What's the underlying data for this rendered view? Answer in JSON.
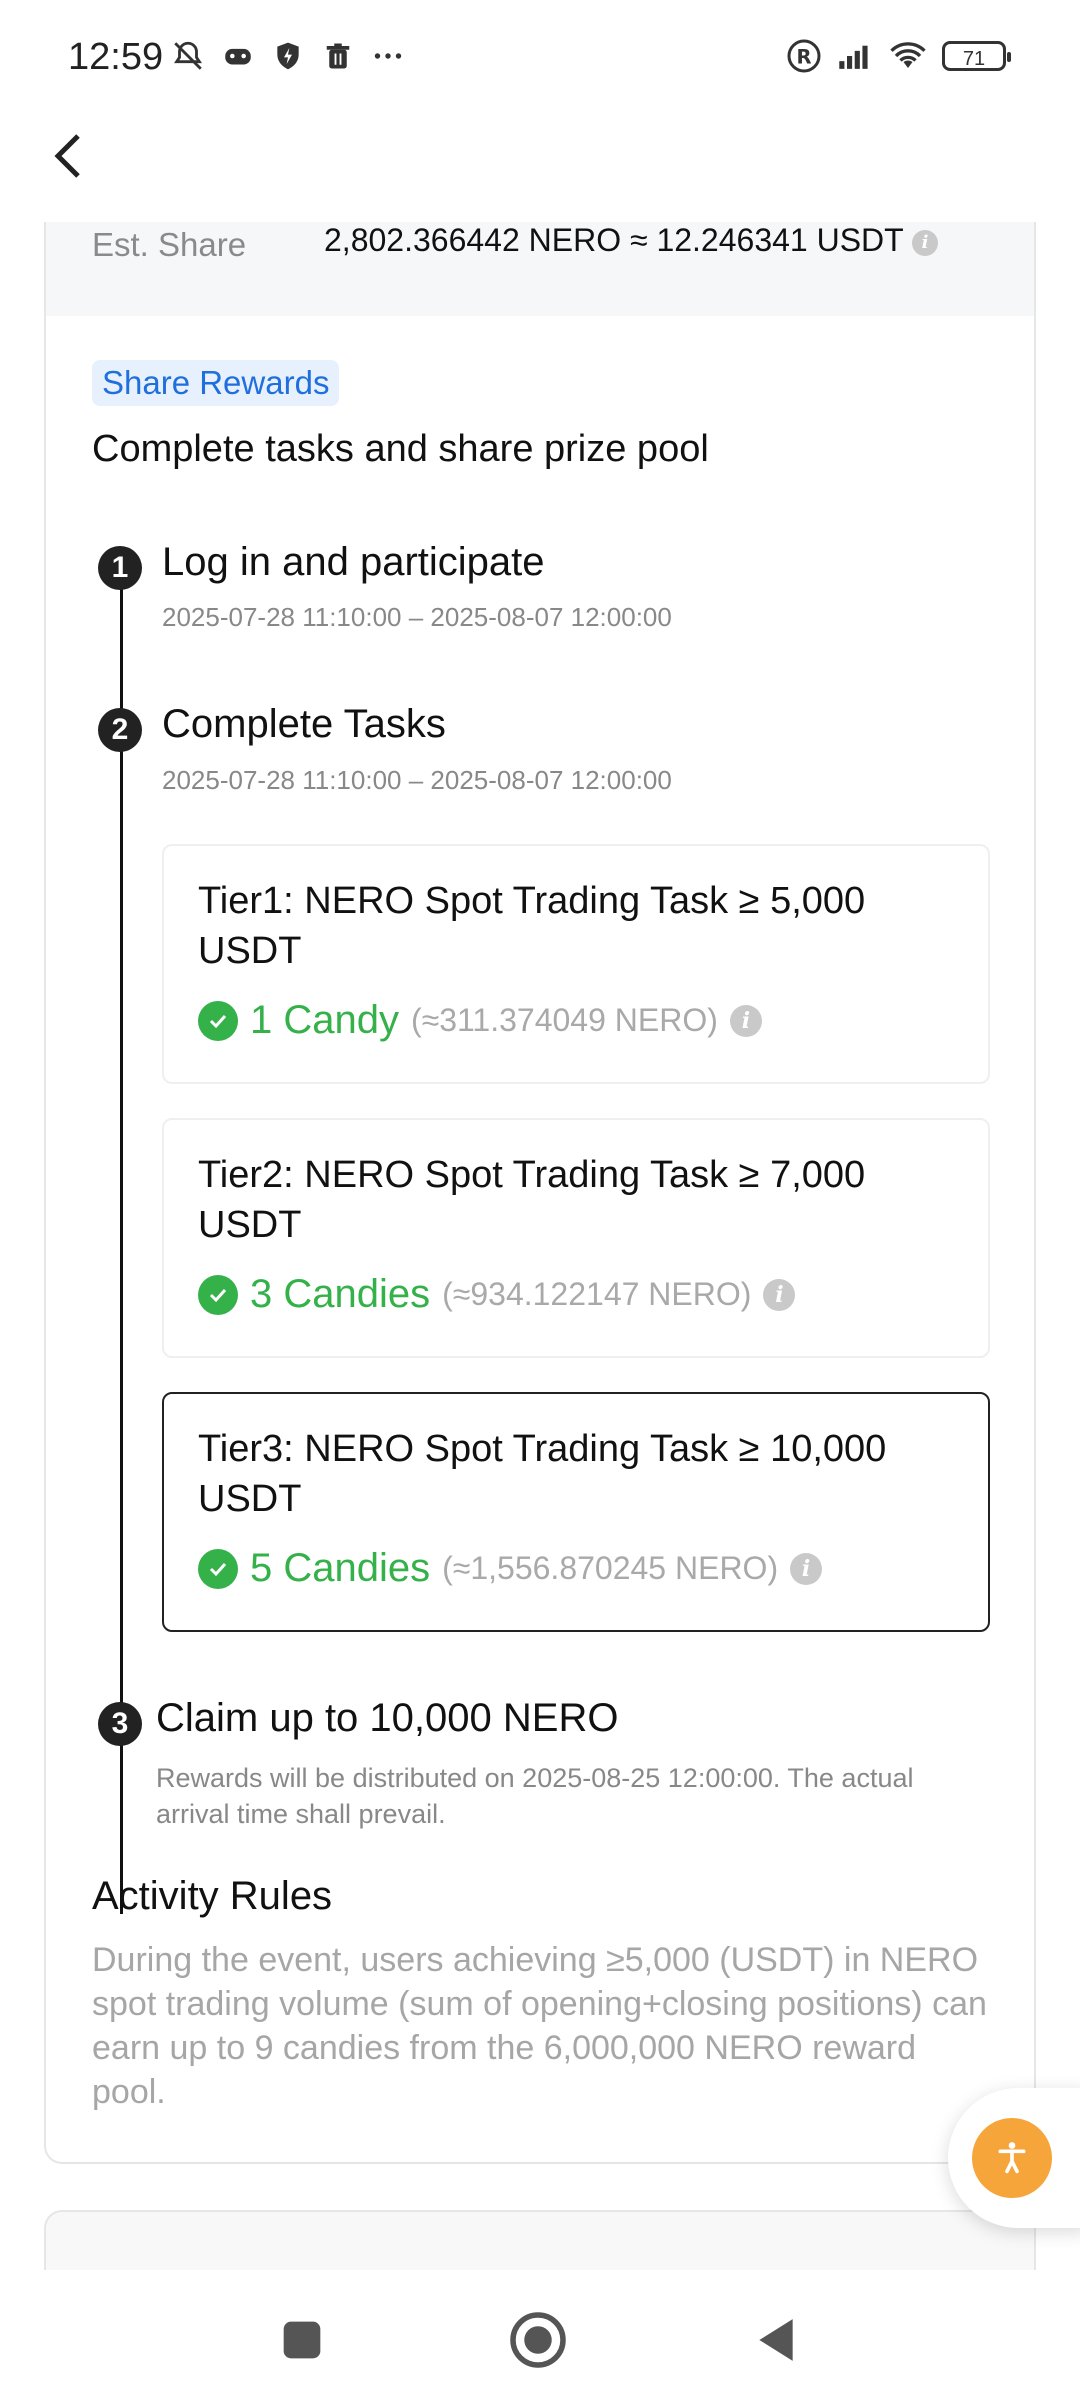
{
  "status_bar": {
    "time": "12:59",
    "battery": "71"
  },
  "share": {
    "label": "Est. Share",
    "value": "2,802.366442 NERO ≈ 12.246341 USDT"
  },
  "badge": "Share Rewards",
  "heading": "Complete tasks and share prize pool",
  "steps": [
    {
      "num": "1",
      "title": "Log in and participate",
      "date": "2025-07-28 11:10:00 – 2025-08-07 12:00:00"
    },
    {
      "num": "2",
      "title": "Complete Tasks",
      "date": "2025-07-28 11:10:00 – 2025-08-07 12:00:00"
    },
    {
      "num": "3",
      "title": "Claim up to 10,000 NERO",
      "desc": "Rewards will be distributed on 2025-08-25 12:00:00. The actual arrival time shall prevail."
    }
  ],
  "tiers": [
    {
      "title": "Tier1: NERO Spot Trading Task ≥ 5,000 USDT",
      "reward": "1 Candy",
      "approx": "(≈311.374049 NERO)"
    },
    {
      "title": "Tier2: NERO Spot Trading Task ≥ 7,000 USDT",
      "reward": "3 Candies",
      "approx": "(≈934.122147 NERO)"
    },
    {
      "title": "Tier3: NERO Spot Trading Task ≥ 10,000 USDT",
      "reward": "5 Candies",
      "approx": "(≈1,556.870245 NERO)"
    }
  ],
  "rules": {
    "title": "Activity Rules",
    "text": "During the event, users achieving ≥5,000 (USDT) in NERO spot trading volume (sum of opening+closing positions) can earn up to 9 candies from the 6,000,000 NERO reward pool."
  },
  "colors": {
    "accent_green": "#35b14a",
    "badge_blue": "#1f6fdc",
    "fab_orange": "#f6a53a"
  }
}
